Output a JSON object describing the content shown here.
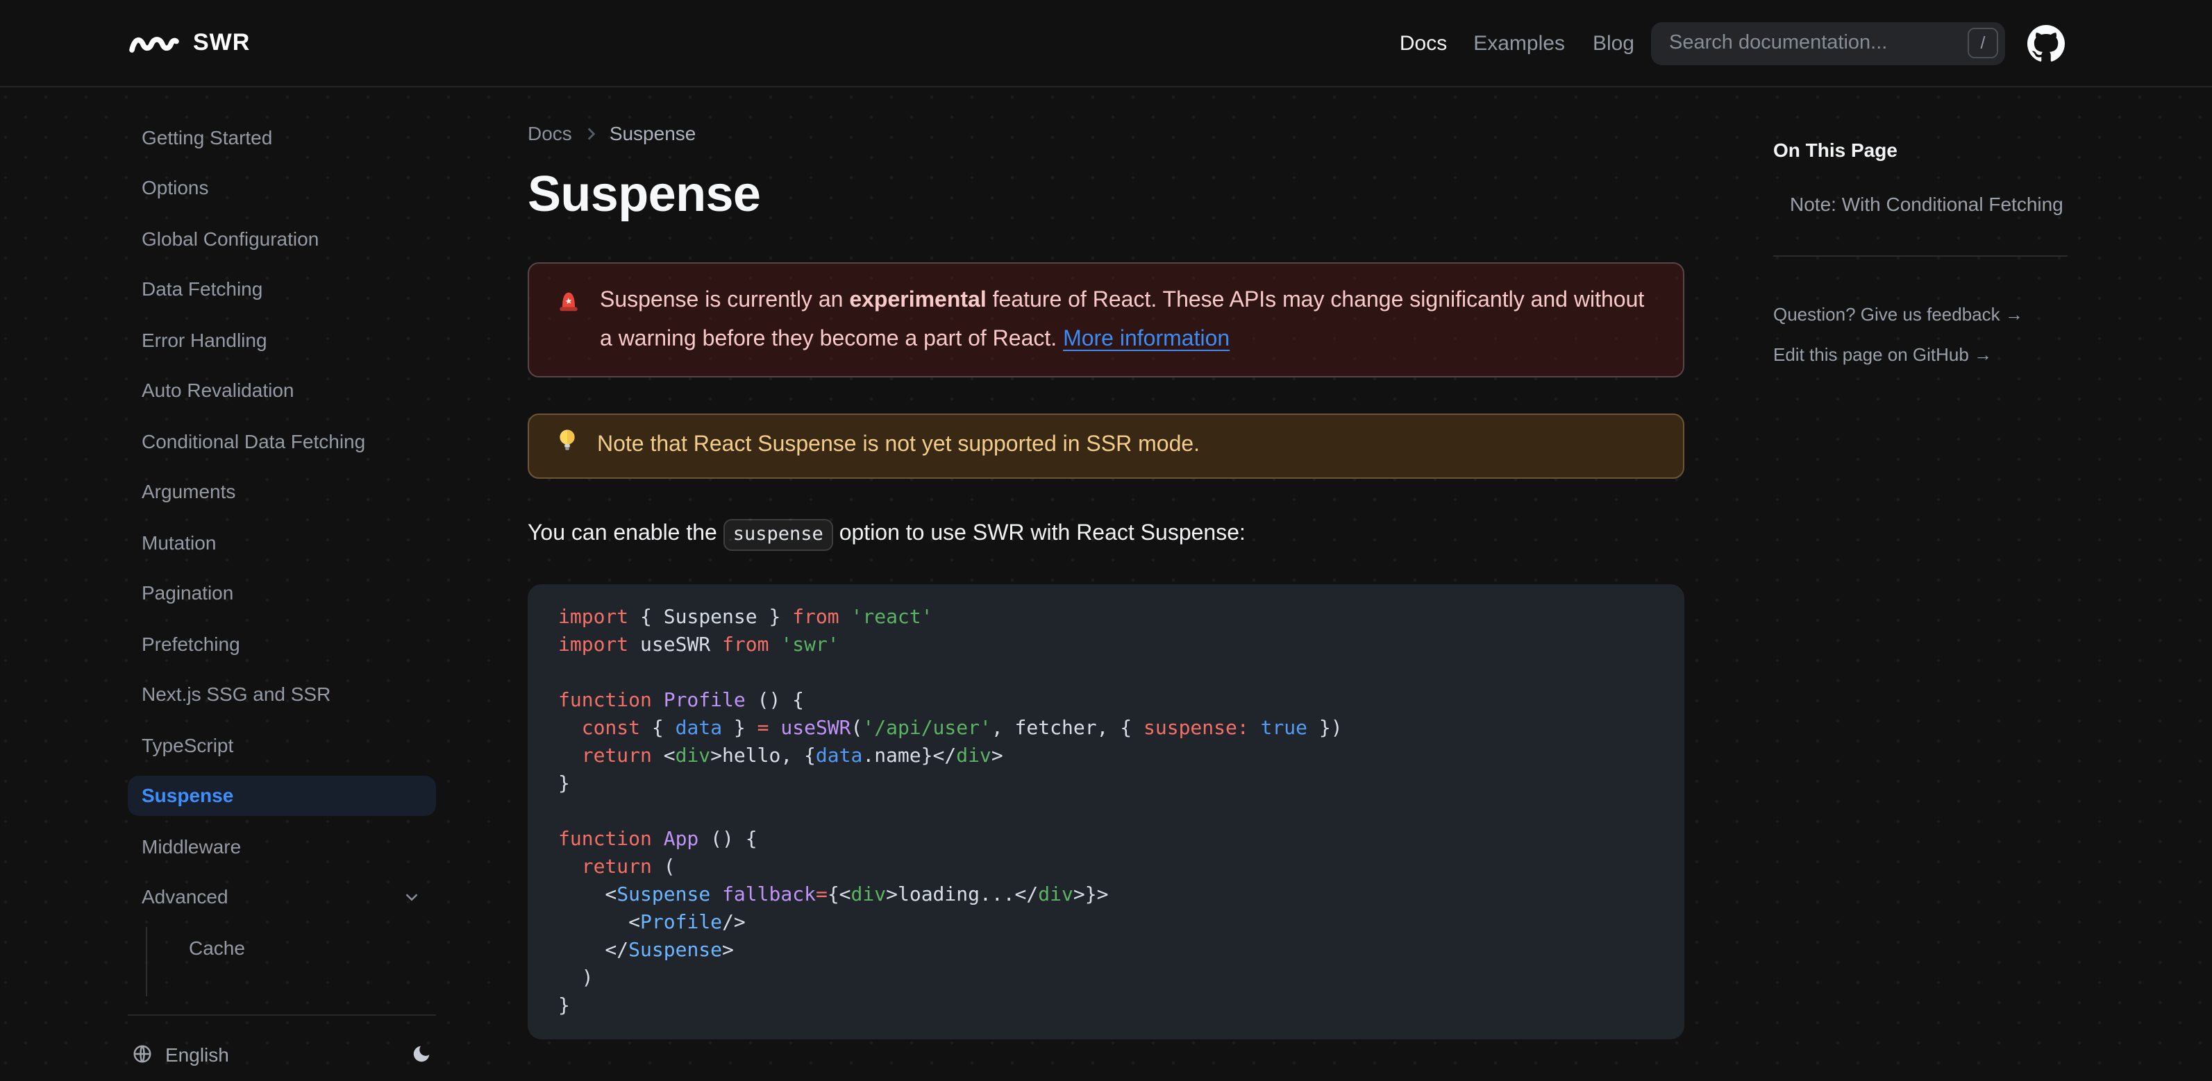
{
  "theme": {
    "background": "#111111",
    "accent_blue": "#3e8ffd",
    "active_item_bg": "#161f2b",
    "warning_text": "#f8caca",
    "note_text": "#f2cd8c",
    "link_blue": "#3c8cf5"
  },
  "navbar": {
    "logo_text": "SWR",
    "links": [
      {
        "label": "Docs",
        "active": true
      },
      {
        "label": "Examples",
        "active": false
      },
      {
        "label": "Blog",
        "active": false
      }
    ],
    "search": {
      "placeholder": "Search documentation...",
      "shortcut": "/"
    },
    "github_icon": "github-icon"
  },
  "sidebar": {
    "items": [
      {
        "label": "Getting Started",
        "slug": "getting-started",
        "active": false,
        "expandable": false
      },
      {
        "label": "Options",
        "slug": "options",
        "active": false,
        "expandable": false
      },
      {
        "label": "Global Configuration",
        "slug": "global-configuration",
        "active": false,
        "expandable": false
      },
      {
        "label": "Data Fetching",
        "slug": "data-fetching",
        "active": false,
        "expandable": false
      },
      {
        "label": "Error Handling",
        "slug": "error-handling",
        "active": false,
        "expandable": false
      },
      {
        "label": "Auto Revalidation",
        "slug": "auto-revalidation",
        "active": false,
        "expandable": false
      },
      {
        "label": "Conditional Data Fetching",
        "slug": "conditional-data-fetching",
        "active": false,
        "expandable": false
      },
      {
        "label": "Arguments",
        "slug": "arguments",
        "active": false,
        "expandable": false
      },
      {
        "label": "Mutation",
        "slug": "mutation",
        "active": false,
        "expandable": false
      },
      {
        "label": "Pagination",
        "slug": "pagination",
        "active": false,
        "expandable": false
      },
      {
        "label": "Prefetching",
        "slug": "prefetching",
        "active": false,
        "expandable": false
      },
      {
        "label": "Next.js SSG and SSR",
        "slug": "nextjs-ssg-and-ssr",
        "active": false,
        "expandable": false
      },
      {
        "label": "TypeScript",
        "slug": "typescript",
        "active": false,
        "expandable": false
      },
      {
        "label": "Suspense",
        "slug": "suspense",
        "active": true,
        "expandable": false
      },
      {
        "label": "Middleware",
        "slug": "middleware",
        "active": false,
        "expandable": false
      },
      {
        "label": "Advanced",
        "slug": "advanced",
        "active": false,
        "expandable": true
      }
    ],
    "child_item": {
      "label": "Cache",
      "slug": "cache"
    },
    "footer": {
      "language": "English",
      "theme_icon": "moon-icon",
      "language_icon": "globe-icon"
    }
  },
  "breadcrumb": {
    "items": [
      "Docs",
      "Suspense"
    ]
  },
  "page": {
    "title": "Suspense"
  },
  "callouts": {
    "warning": {
      "icon": "siren-light-icon",
      "text_before": "Suspense is currently an ",
      "bold": "experimental",
      "text_after": " feature of React. These APIs may change significantly and without a warning before they become a part of React.",
      "link_label": "More information"
    },
    "note": {
      "icon": "lightbulb-icon",
      "text": "Note that React Suspense is not yet supported in SSR mode."
    }
  },
  "paragraph": {
    "before": "You can enable the ",
    "code": "suspense",
    "after": " option to use SWR with React Suspense:"
  },
  "code_block": {
    "language": "jsx",
    "colors": {
      "k": "#f47067",
      "s": "#5bb363",
      "p": "#bf94f7",
      "b": "#539bf5",
      "c": "#6cb6ff",
      "w": "#d8dee6"
    },
    "lines": [
      [
        {
          "t": "import ",
          "c": "k"
        },
        {
          "t": "{ Suspense } ",
          "c": "w"
        },
        {
          "t": "from ",
          "c": "k"
        },
        {
          "t": "'react'",
          "c": "s"
        }
      ],
      [
        {
          "t": "import ",
          "c": "k"
        },
        {
          "t": "useSWR ",
          "c": "w"
        },
        {
          "t": "from ",
          "c": "k"
        },
        {
          "t": "'swr'",
          "c": "s"
        }
      ],
      [],
      [
        {
          "t": "function ",
          "c": "k"
        },
        {
          "t": "Profile",
          "c": "p"
        },
        {
          "t": " () {",
          "c": "w"
        }
      ],
      [
        {
          "t": "  const",
          "c": "k"
        },
        {
          "t": " { ",
          "c": "w"
        },
        {
          "t": "data",
          "c": "b"
        },
        {
          "t": " } ",
          "c": "w"
        },
        {
          "t": "= ",
          "c": "k"
        },
        {
          "t": "useSWR",
          "c": "p"
        },
        {
          "t": "(",
          "c": "w"
        },
        {
          "t": "'/api/user'",
          "c": "s"
        },
        {
          "t": ", fetcher, { ",
          "c": "w"
        },
        {
          "t": "suspense:",
          "c": "k"
        },
        {
          "t": " ",
          "c": "w"
        },
        {
          "t": "true",
          "c": "b"
        },
        {
          "t": " })",
          "c": "w"
        }
      ],
      [
        {
          "t": "  return",
          "c": "k"
        },
        {
          "t": " <",
          "c": "w"
        },
        {
          "t": "div",
          "c": "s"
        },
        {
          "t": ">hello, {",
          "c": "w"
        },
        {
          "t": "data",
          "c": "b"
        },
        {
          "t": ".name}</",
          "c": "w"
        },
        {
          "t": "div",
          "c": "s"
        },
        {
          "t": ">",
          "c": "w"
        }
      ],
      [
        {
          "t": "}",
          "c": "w"
        }
      ],
      [],
      [
        {
          "t": "function ",
          "c": "k"
        },
        {
          "t": "App",
          "c": "p"
        },
        {
          "t": " () {",
          "c": "w"
        }
      ],
      [
        {
          "t": "  return",
          "c": "k"
        },
        {
          "t": " (",
          "c": "w"
        }
      ],
      [
        {
          "t": "    <",
          "c": "w"
        },
        {
          "t": "Suspense",
          "c": "c"
        },
        {
          "t": " ",
          "c": "w"
        },
        {
          "t": "fallback",
          "c": "p"
        },
        {
          "t": "=",
          "c": "k"
        },
        {
          "t": "{<",
          "c": "w"
        },
        {
          "t": "div",
          "c": "s"
        },
        {
          "t": ">loading...</",
          "c": "w"
        },
        {
          "t": "div",
          "c": "s"
        },
        {
          "t": ">}>",
          "c": "w"
        }
      ],
      [
        {
          "t": "      <",
          "c": "w"
        },
        {
          "t": "Profile",
          "c": "c"
        },
        {
          "t": "/>",
          "c": "w"
        }
      ],
      [
        {
          "t": "    </",
          "c": "w"
        },
        {
          "t": "Suspense",
          "c": "c"
        },
        {
          "t": ">",
          "c": "w"
        }
      ],
      [
        {
          "t": "  )",
          "c": "w"
        }
      ],
      [
        {
          "t": "}",
          "c": "w"
        }
      ]
    ]
  },
  "toc": {
    "heading": "On This Page",
    "items": [
      "Note: With Conditional Fetching"
    ],
    "links": [
      "Question? Give us feedback →",
      "Edit this page on GitHub →"
    ]
  }
}
